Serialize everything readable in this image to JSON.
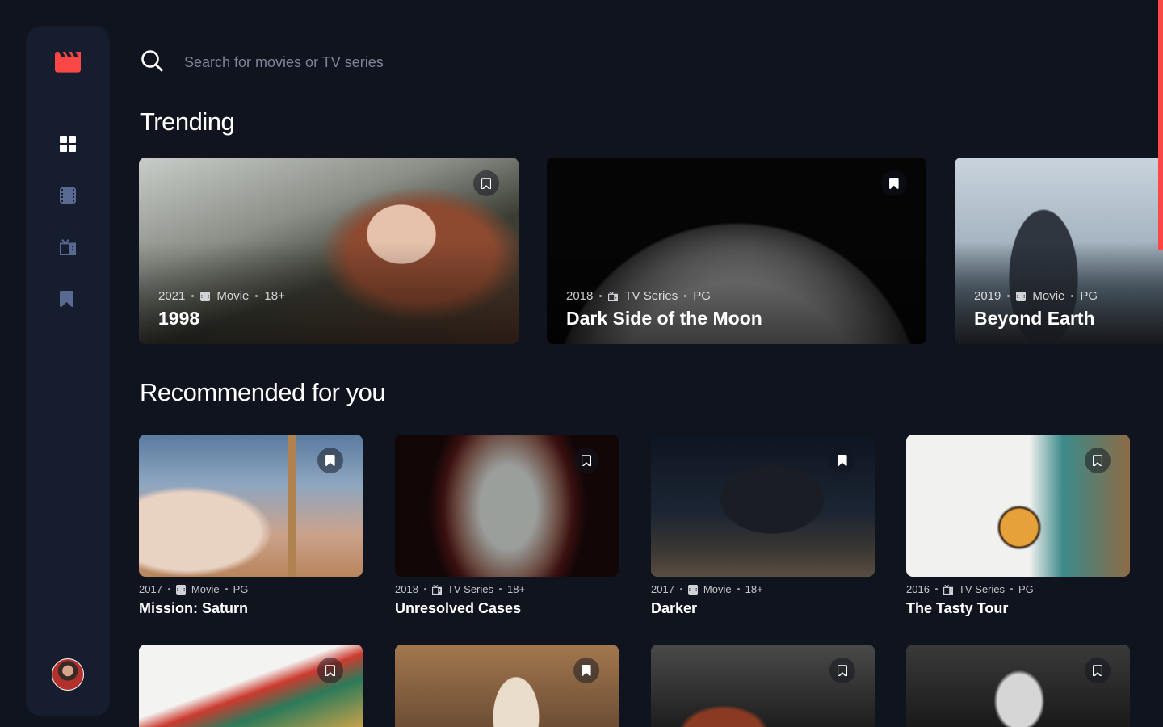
{
  "app": {
    "brand_color": "#FC4747",
    "background": "#10141E",
    "surface": "#161D2F"
  },
  "sidebar": {
    "logo_icon": "clapperboard-icon",
    "items": [
      {
        "name": "home",
        "icon": "grid-icon",
        "active": true
      },
      {
        "name": "movies",
        "icon": "film-icon",
        "active": false
      },
      {
        "name": "tv-series",
        "icon": "tv-icon",
        "active": false
      },
      {
        "name": "bookmarks",
        "icon": "bookmark-icon",
        "active": false
      }
    ],
    "avatar_icon": "avatar"
  },
  "search": {
    "placeholder": "Search for movies or TV series",
    "value": ""
  },
  "trending": {
    "title": "Trending",
    "items": [
      {
        "year": "2021",
        "category": "Movie",
        "rating": "18+",
        "title": "1998"
      },
      {
        "year": "2018",
        "category": "TV Series",
        "rating": "PG",
        "title": "Dark Side of the Moon"
      },
      {
        "year": "2019",
        "category": "Movie",
        "rating": "PG",
        "title": "Beyond Earth"
      }
    ]
  },
  "recommended": {
    "title": "Recommended for you",
    "items": [
      {
        "year": "2017",
        "category": "Movie",
        "rating": "PG",
        "title": "Mission: Saturn",
        "bookmarked": true
      },
      {
        "year": "2018",
        "category": "TV Series",
        "rating": "18+",
        "title": "Unresolved Cases",
        "bookmarked": false
      },
      {
        "year": "2017",
        "category": "Movie",
        "rating": "18+",
        "title": "Darker",
        "bookmarked": true
      },
      {
        "year": "2016",
        "category": "TV Series",
        "rating": "PG",
        "title": "The Tasty Tour",
        "bookmarked": false
      },
      {
        "bookmarked": false
      },
      {
        "bookmarked": true
      },
      {
        "bookmarked": false
      },
      {
        "bookmarked": false
      }
    ]
  }
}
